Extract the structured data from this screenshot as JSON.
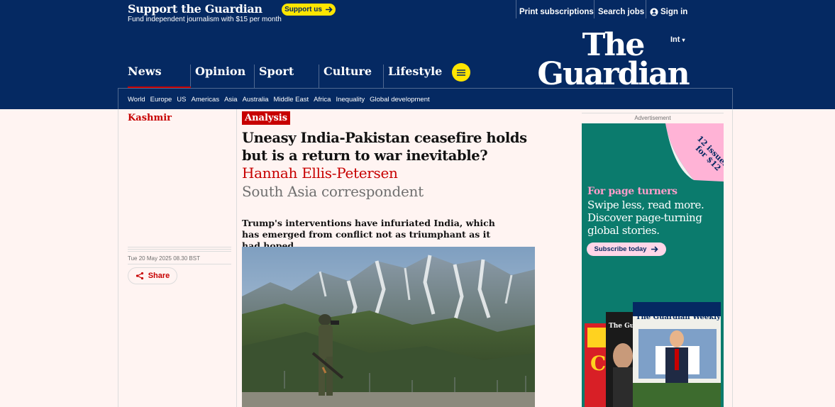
{
  "support": {
    "title": "Support the Guardian",
    "subtitle": "Fund independent journalism with $15 per month",
    "button": "Support us"
  },
  "topnav": {
    "print": "Print subscriptions",
    "jobs": "Search jobs",
    "signin": "Sign in"
  },
  "masthead": {
    "edition": "Int",
    "logo_line1": "The",
    "logo_line2": "Guardian",
    "pillars": [
      "News",
      "Opinion",
      "Sport",
      "Culture",
      "Lifestyle"
    ],
    "active_pillar": "News",
    "subnav": [
      "World",
      "Europe",
      "US",
      "Americas",
      "Asia",
      "Australia",
      "Middle East",
      "Africa",
      "Inequality",
      "Global development"
    ]
  },
  "article": {
    "section": "Kashmir",
    "badge": "Analysis",
    "headline": "Uneasy India-Pakistan ceasefire holds but is a return to war inevitable?",
    "byline": "Hannah Ellis-Petersen",
    "role": "South Asia correspondent",
    "standfirst": "Trump's interventions have infuriated India, which has emerged from conflict not as triumphant as it had hoped",
    "date": "Tue 20 May 2025 08.30 BST",
    "share": "Share"
  },
  "ad": {
    "label": "Advertisement",
    "flag_line1": "12 issues",
    "flag_line2": "for $12",
    "headline": "For page turners",
    "body": "Swipe less, read more. Discover page-turning global stories.",
    "button": "Subscribe today",
    "mag_title": "The Guardian",
    "mag_weekly": "The Guardian Weekly"
  },
  "colors": {
    "brand_blue": "#052962",
    "accent_red": "#c70000",
    "highlight_yellow": "#ffe500",
    "ad_green": "#0b7b6d",
    "ad_pink": "#ff9ecb"
  }
}
